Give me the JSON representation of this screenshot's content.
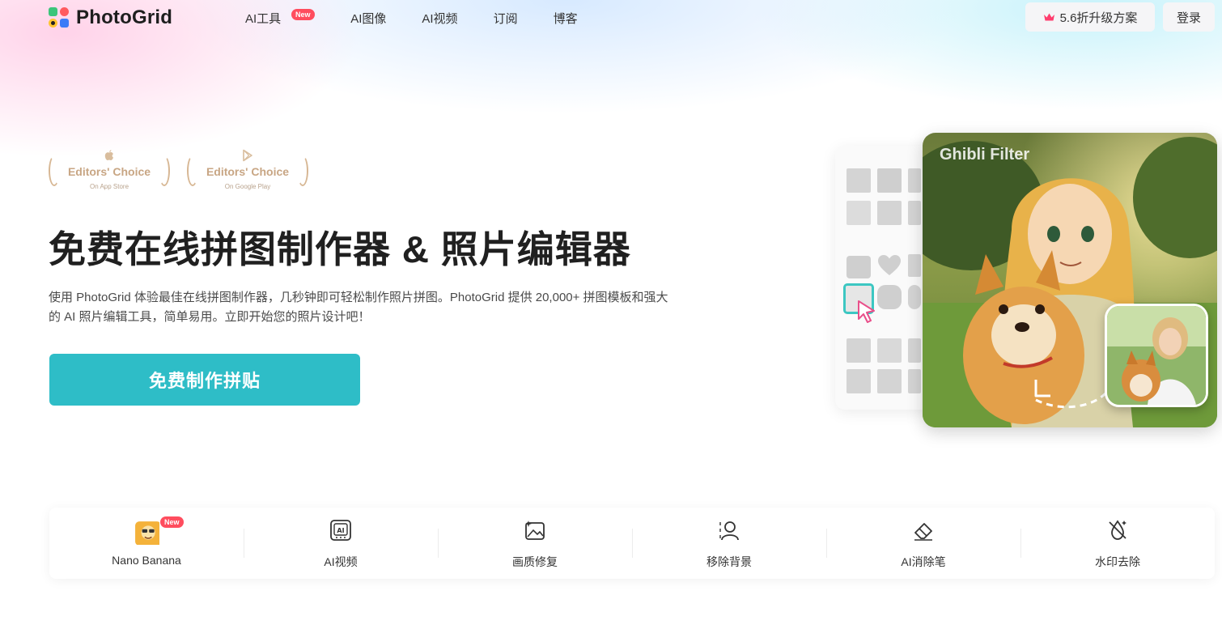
{
  "brand": {
    "name": "PhotoGrid"
  },
  "nav": {
    "items": [
      {
        "label": "AI工具",
        "badge": "New"
      },
      {
        "label": "AI图像"
      },
      {
        "label": "AI视频"
      },
      {
        "label": "订阅"
      },
      {
        "label": "博客"
      }
    ]
  },
  "header": {
    "upgrade_label": "5.6折升级方案",
    "login_label": "登录"
  },
  "awards": [
    {
      "title": "Editors' Choice",
      "subtitle": "On App Store",
      "icon": "apple-icon"
    },
    {
      "title": "Editors' Choice",
      "subtitle": "On Google Play",
      "icon": "google-play-icon"
    }
  ],
  "hero": {
    "title": "免费在线拼图制作器 & 照片编辑器",
    "description": "使用 PhotoGrid 体验最佳在线拼图制作器，几秒钟即可轻松制作照片拼图。PhotoGrid 提供 20,000+ 拼图模板和强大的 AI 照片编辑工具，简单易用。立即开始您的照片设计吧！",
    "cta_label": "免费制作拼贴"
  },
  "showcase": {
    "filter_label": "Ghibli Filter"
  },
  "tools": [
    {
      "label": "Nano Banana",
      "icon": "nano-banana-icon",
      "badge": "New"
    },
    {
      "label": "AI视频",
      "icon": "ai-video-icon"
    },
    {
      "label": "画质修复",
      "icon": "image-enhance-icon"
    },
    {
      "label": "移除背景",
      "icon": "remove-background-icon"
    },
    {
      "label": "AI消除笔",
      "icon": "eraser-icon"
    },
    {
      "label": "水印去除",
      "icon": "watermark-remove-icon"
    }
  ],
  "colors": {
    "accent": "#2ebdc7",
    "badge": "#ff4d5e",
    "award": "#c8a684"
  }
}
